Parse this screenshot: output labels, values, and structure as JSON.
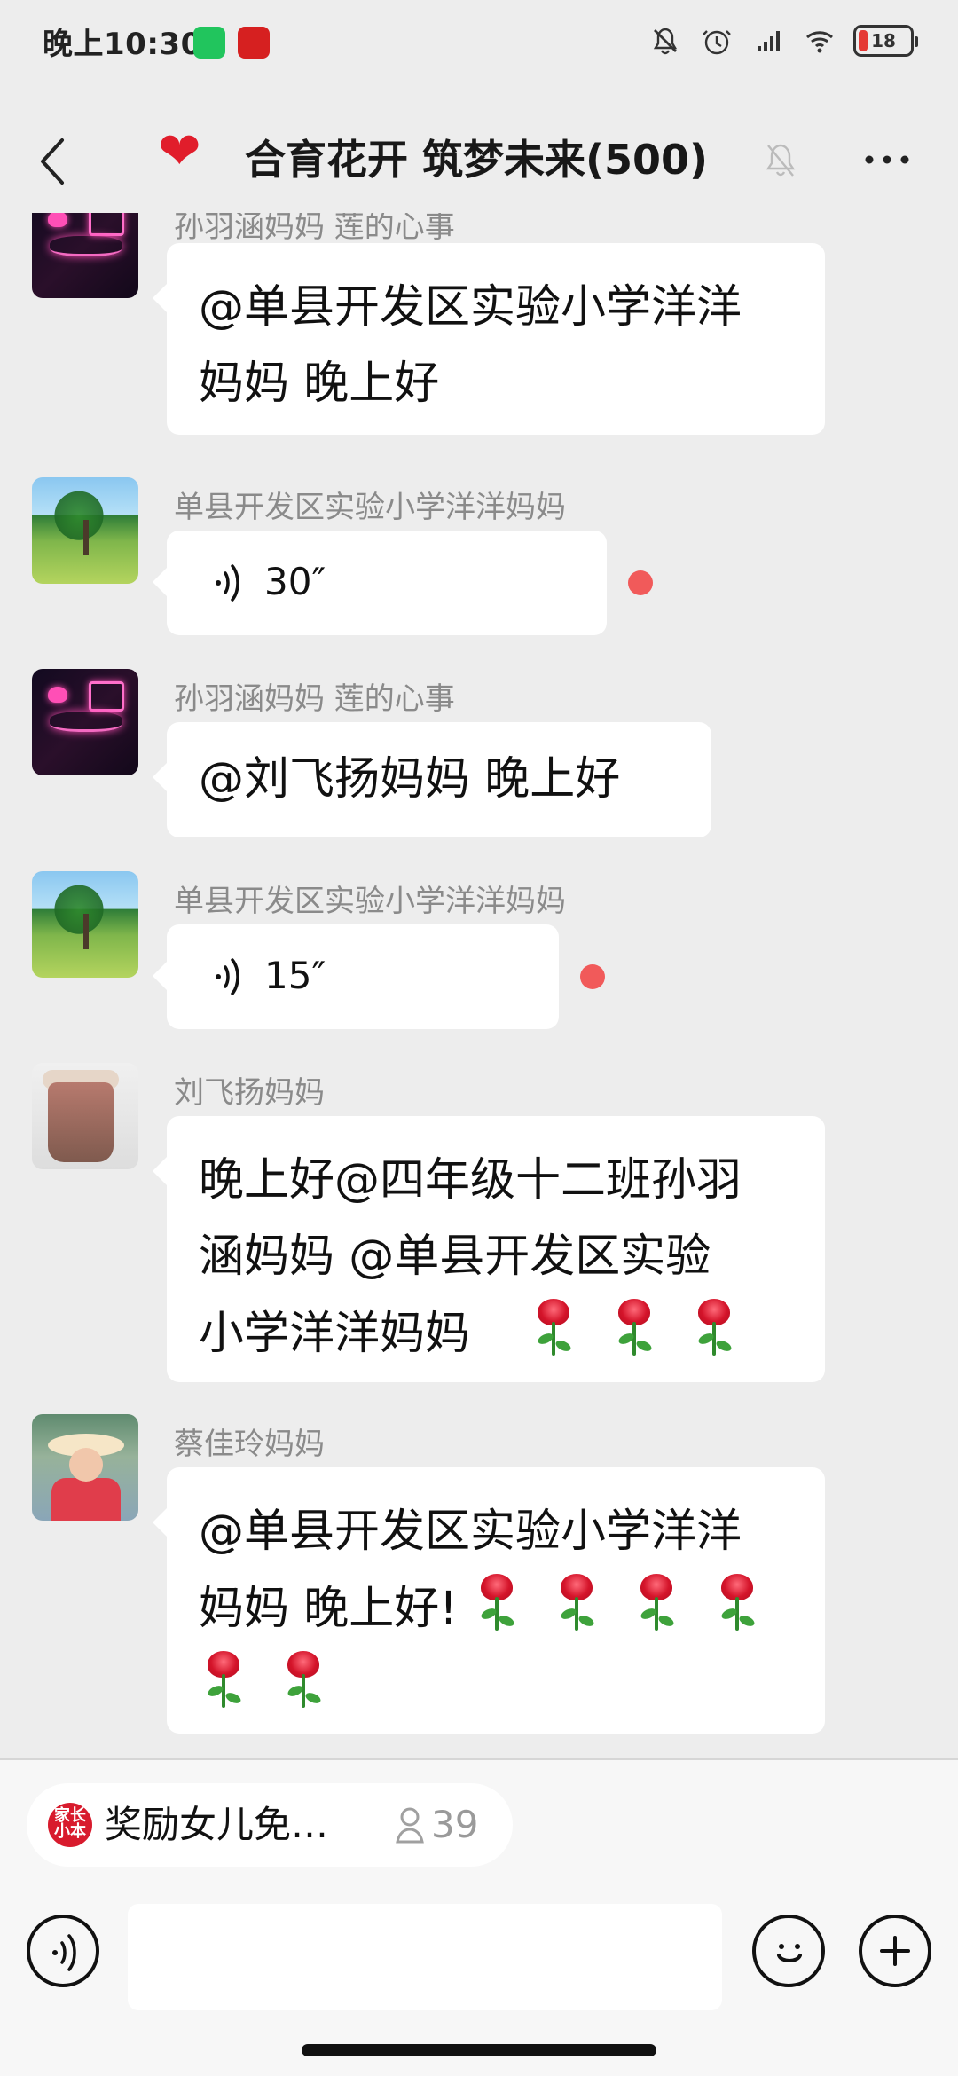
{
  "status_bar": {
    "time": "晚上10:30",
    "battery": "18"
  },
  "header": {
    "title": "合育花开 筑梦未来(500)",
    "heart": "❤"
  },
  "messages": [
    {
      "sender": "孙羽涵妈妈  莲的心事",
      "lines": [
        "@单县开发区实验小学洋洋",
        "妈妈  晚上好"
      ]
    },
    {
      "sender": "单县开发区实验小学洋洋妈妈",
      "voice_duration": "30″"
    },
    {
      "sender": "孙羽涵妈妈  莲的心事",
      "lines": [
        "@刘飞扬妈妈  晚上好"
      ]
    },
    {
      "sender": "单县开发区实验小学洋洋妈妈",
      "voice_duration": "15″"
    },
    {
      "sender": "刘飞扬妈妈",
      "lines": [
        "晚上好@四年级十二班孙羽",
        "涵妈妈  @单县开发区实验",
        "小学洋洋妈妈"
      ],
      "rose_count": 3
    },
    {
      "sender": "蔡佳玲妈妈",
      "lines": [
        "@单县开发区实验小学洋洋",
        "妈妈  晚上好!"
      ],
      "rose_count_line2": 4,
      "rose_count_line3": 2
    }
  ],
  "notice": {
    "logo_text": "家长小本",
    "text": "奖励女儿免…",
    "count": "39"
  },
  "input": {
    "placeholder": ""
  },
  "colors": {
    "background": "#ededed",
    "bubble": "#ffffff",
    "unread_dot": "#f15a5a",
    "accent_red": "#e11d2b"
  }
}
